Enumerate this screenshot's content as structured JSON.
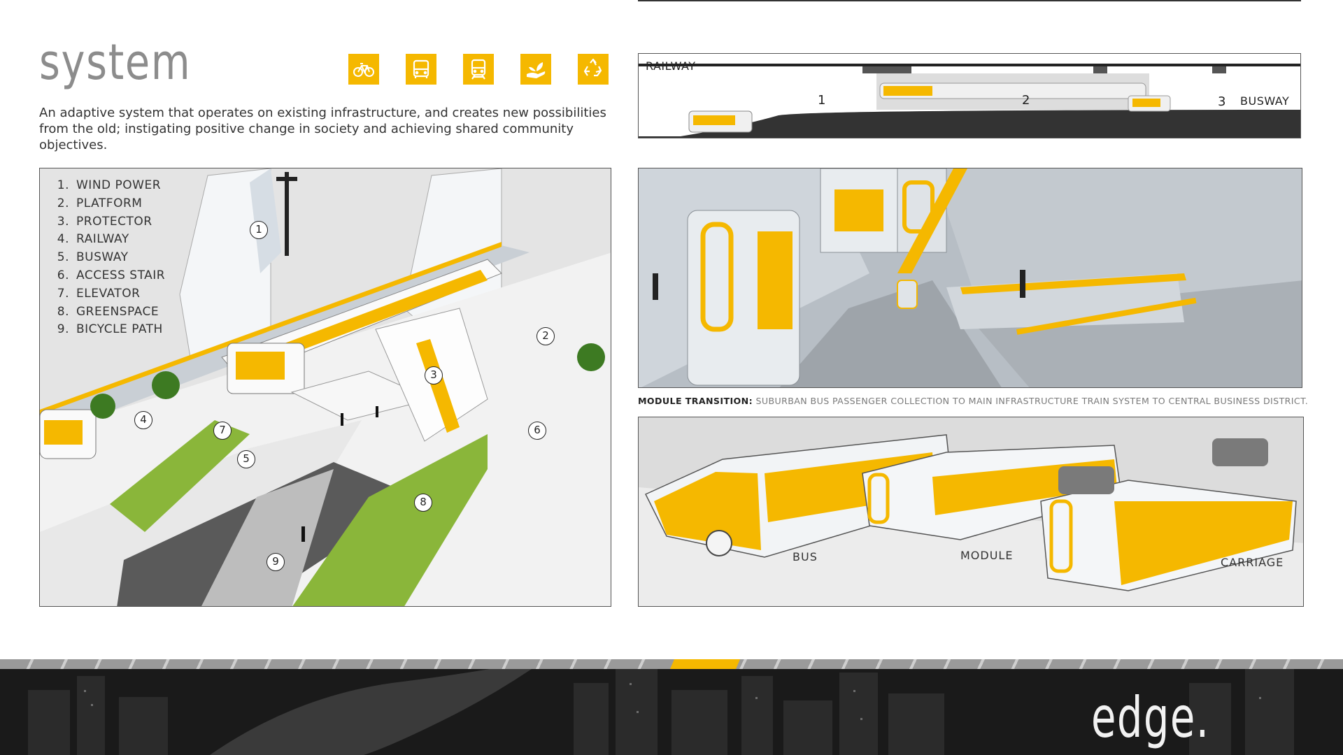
{
  "header": {
    "title": "system",
    "intro": "An adaptive system that operates on existing infrastructure, and creates new possibilities from the old; instigating positive change in society and achieving shared community objectives.",
    "icons": [
      "bicycle-icon",
      "bus-icon",
      "train-icon",
      "plant-hand-icon",
      "recycle-icon"
    ]
  },
  "legend": [
    {
      "num": "1.",
      "label": "WIND POWER"
    },
    {
      "num": "2.",
      "label": "PLATFORM"
    },
    {
      "num": "3.",
      "label": "PROTECTOR"
    },
    {
      "num": "4.",
      "label": "RAILWAY"
    },
    {
      "num": "5.",
      "label": "BUSWAY"
    },
    {
      "num": "6.",
      "label": "ACCESS STAIR"
    },
    {
      "num": "7.",
      "label": "ELEVATOR"
    },
    {
      "num": "8.",
      "label": "GREENSPACE"
    },
    {
      "num": "9.",
      "label": "BICYCLE PATH"
    }
  ],
  "callouts": [
    "1",
    "2",
    "3",
    "4",
    "5",
    "6",
    "7",
    "8",
    "9"
  ],
  "section": {
    "railway_label": "RAILWAY",
    "busway_label": "BUSWAY",
    "stage_1": "1",
    "stage_2": "2",
    "stage_3": "3"
  },
  "caption": {
    "head": "MODULE TRANSITION:",
    "body": "SUBURBAN BUS PASSENGER COLLECTION TO MAIN INFRASTRUCTURE TRAIN SYSTEM TO CENTRAL BUSINESS DISTRICT."
  },
  "modules": {
    "bus": "BUS",
    "module": "MODULE",
    "carriage": "CARRIAGE"
  },
  "footer": {
    "brand": "edge."
  },
  "colors": {
    "accent": "#f5b800",
    "title_gray": "#8c8c8c",
    "green": "#8ab63a"
  }
}
